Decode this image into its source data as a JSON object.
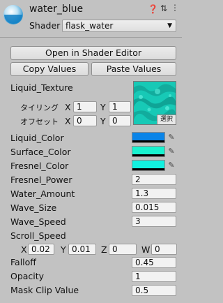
{
  "header": {
    "material_name": "water_blue",
    "shader_label": "Shader",
    "shader_value": "flask_water"
  },
  "buttons": {
    "open_shader_editor": "Open in Shader Editor",
    "copy_values": "Copy Values",
    "paste_values": "Paste Values"
  },
  "texture": {
    "label": "Liquid_Texture",
    "tiling_label": "タイリング",
    "offset_label": "オフセット",
    "tiling_x": "1",
    "tiling_y": "1",
    "offset_x": "0",
    "offset_y": "0",
    "select_label": "選択",
    "x_label": "X",
    "y_label": "Y"
  },
  "colors": {
    "liquid_color": {
      "label": "Liquid_Color",
      "hex": "#0a84e8"
    },
    "surface_color": {
      "label": "Surface_Color",
      "hex": "#19f2cf"
    },
    "fresnel_color": {
      "label": "Fresnel_Color",
      "hex": "#12f0df"
    }
  },
  "properties": [
    {
      "label": "Fresnel_Power",
      "value": "2"
    },
    {
      "label": "Water_Amount",
      "value": "1.3"
    },
    {
      "label": "Wave_Size",
      "value": "0.015"
    },
    {
      "label": "Wave_Speed",
      "value": "3"
    }
  ],
  "scroll_speed": {
    "label": "Scroll_Speed",
    "x_label": "X",
    "x": "0.02",
    "y_label": "Y",
    "y": "0.01",
    "z_label": "Z",
    "z": "0",
    "w_label": "W",
    "w": "0"
  },
  "lower_properties": [
    {
      "label": "Falloff",
      "value": "0.45"
    },
    {
      "label": "Opacity",
      "value": "1"
    },
    {
      "label": "Mask Clip Value",
      "value": "0.5"
    }
  ]
}
